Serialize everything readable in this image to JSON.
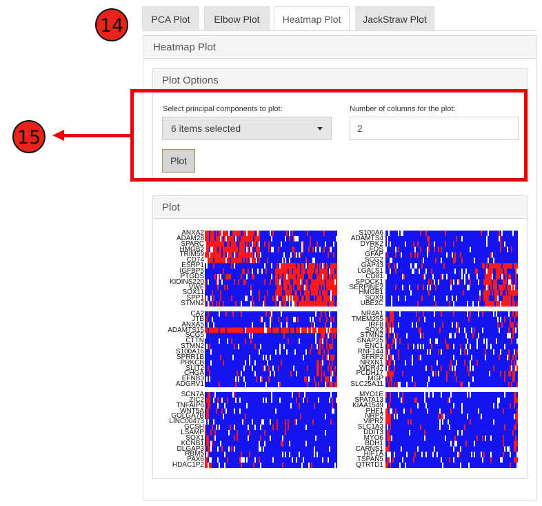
{
  "annotations": {
    "badge_14": "14",
    "badge_15": "15"
  },
  "tabs": [
    {
      "label": "PCA Plot",
      "active": false
    },
    {
      "label": "Elbow Plot",
      "active": false
    },
    {
      "label": "Heatmap Plot",
      "active": true
    },
    {
      "label": "JackStraw Plot",
      "active": false
    }
  ],
  "heatmap_panel": {
    "title": "Heatmap Plot"
  },
  "plot_options": {
    "title": "Plot Options",
    "pc_label": "Select principal components to plot:",
    "pc_value": "6 items selected",
    "ncol_label": "Number of columns for the plot:",
    "ncol_value": "2",
    "plot_button": "Plot"
  },
  "plot_panel": {
    "title": "Plot"
  },
  "colors": {
    "high": "#ff1a1a",
    "low": "#1414f0",
    "mid": "#ffffff",
    "accent_red": "#e00000"
  },
  "heatmaps": [
    {
      "genes": [
        "ANXA2",
        "ADAM28",
        "SPARC",
        "HMGB2",
        "TRIM59",
        "CD74",
        "ESRP1",
        "IGFBP5",
        "PTGDS",
        "KIDINS220",
        "VWF",
        "SOX11",
        "SPP1",
        "STMN2"
      ]
    },
    {
      "genes": [
        "S100A6",
        "ADAMTS4",
        "DYRK2",
        "FOS",
        "GFAP",
        "SCG2",
        "GAP43",
        "LGALS1",
        "CD81",
        "SPOCK1",
        "SERPINE2",
        "HMGB1",
        "SOX9",
        "UBE2C"
      ]
    },
    {
      "genes": [
        "CA2",
        "JTB",
        "ANXA5",
        "ADAMTS15",
        "SCG5",
        "CTTN",
        "STMN2",
        "S100A16",
        "SPRR1B",
        "PRKCB",
        "SLIT2",
        "CHGA",
        "EFNB3",
        "ADGRV1"
      ]
    },
    {
      "genes": [
        "NR4A1",
        "TMEM255",
        "IRF8",
        "SOX2",
        "STMN2",
        "SNAP25",
        "ENC1",
        "RNF144",
        "SFRP2",
        "NRXN1",
        "WDR47",
        "PCDH17",
        "MGP",
        "SLC25A11"
      ]
    },
    {
      "genes": [
        "SCN7A",
        "ZIC2",
        "TNFAIP6",
        "WNT5A",
        "GOLGA7B",
        "LINC00473",
        "GCSH",
        "LSAMP",
        "SOX1",
        "KCNB1",
        "DLGAP3",
        "RBM5",
        "PAX6",
        "HDAC1P2"
      ]
    },
    {
      "genes": [
        "MYO1E",
        "SPATA13",
        "KIAA1549",
        "PHF1",
        "NRP2",
        "VIPR2",
        "SLC1A3",
        "DDIT3",
        "MYO6",
        "BDH1",
        "CARNS1",
        "HIF1A",
        "TSPAN5",
        "QTRTD1"
      ]
    }
  ]
}
